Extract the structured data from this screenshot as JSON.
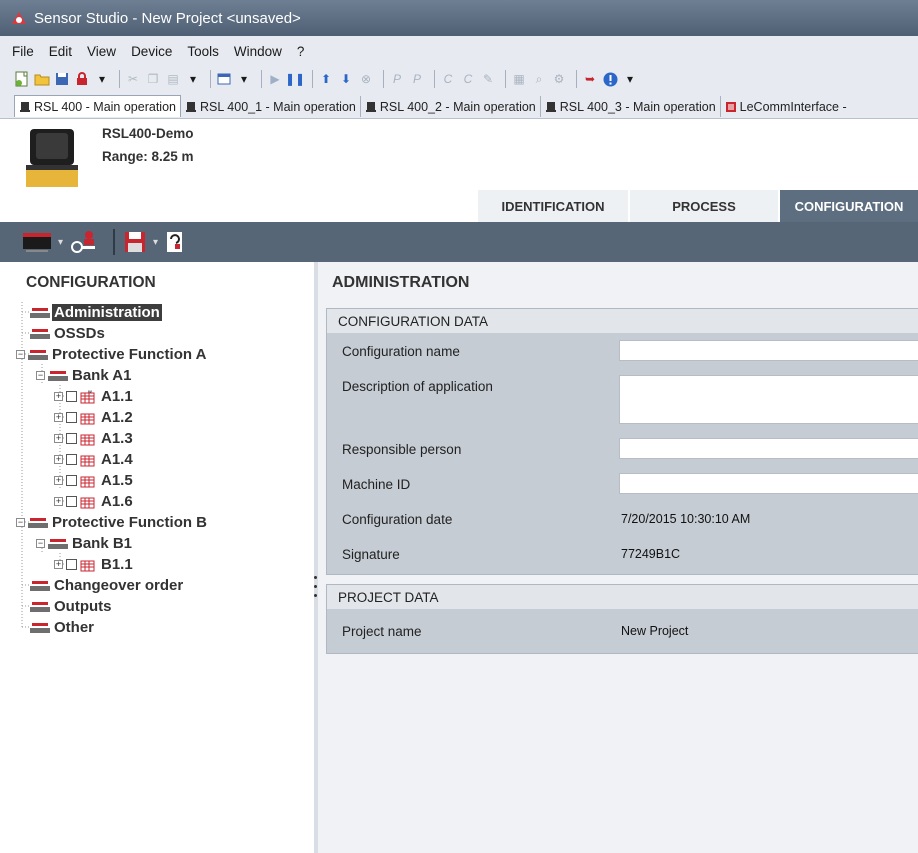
{
  "window": {
    "title": "Sensor Studio - New Project  <unsaved>"
  },
  "menu": [
    "File",
    "Edit",
    "View",
    "Device",
    "Tools",
    "Window",
    "?"
  ],
  "doc_tabs": [
    "RSL 400 - Main operation",
    "RSL 400_1 - Main operation",
    "RSL 400_2 - Main operation",
    "RSL 400_3 - Main operation",
    "LeCommInterface -"
  ],
  "device": {
    "name": "RSL400-Demo",
    "range": "Range: 8.25 m"
  },
  "nav_tabs": [
    "IDENTIFICATION",
    "PROCESS",
    "CONFIGURATION"
  ],
  "left": {
    "heading": "CONFIGURATION",
    "tree": {
      "administration": "Administration",
      "ossds": "OSSDs",
      "pfa": "Protective Function A",
      "bank_a1": "Bank A1",
      "a1": "A1.1",
      "a2": "A1.2",
      "a3": "A1.3",
      "a4": "A1.4",
      "a5": "A1.5",
      "a6": "A1.6",
      "pfb": "Protective Function B",
      "bank_b1": "Bank B1",
      "b1": "B1.1",
      "changeover": "Changeover order",
      "outputs": "Outputs",
      "other": "Other"
    }
  },
  "right": {
    "heading": "ADMINISTRATION",
    "config_section": {
      "title": "CONFIGURATION DATA",
      "config_name_label": "Configuration name",
      "description_label": "Description of application",
      "responsible_label": "Responsible person",
      "machine_id_label": "Machine ID",
      "config_date_label": "Configuration date",
      "config_date_value": "7/20/2015 10:30:10 AM",
      "signature_label": "Signature",
      "signature_value": "77249B1C"
    },
    "project_section": {
      "title": "PROJECT DATA",
      "project_name_label": "Project name",
      "project_name_value": "New Project"
    }
  },
  "colors": {
    "accent_red": "#c8252f",
    "nav_active": "#5d6e80",
    "dark_bar": "#566676"
  }
}
